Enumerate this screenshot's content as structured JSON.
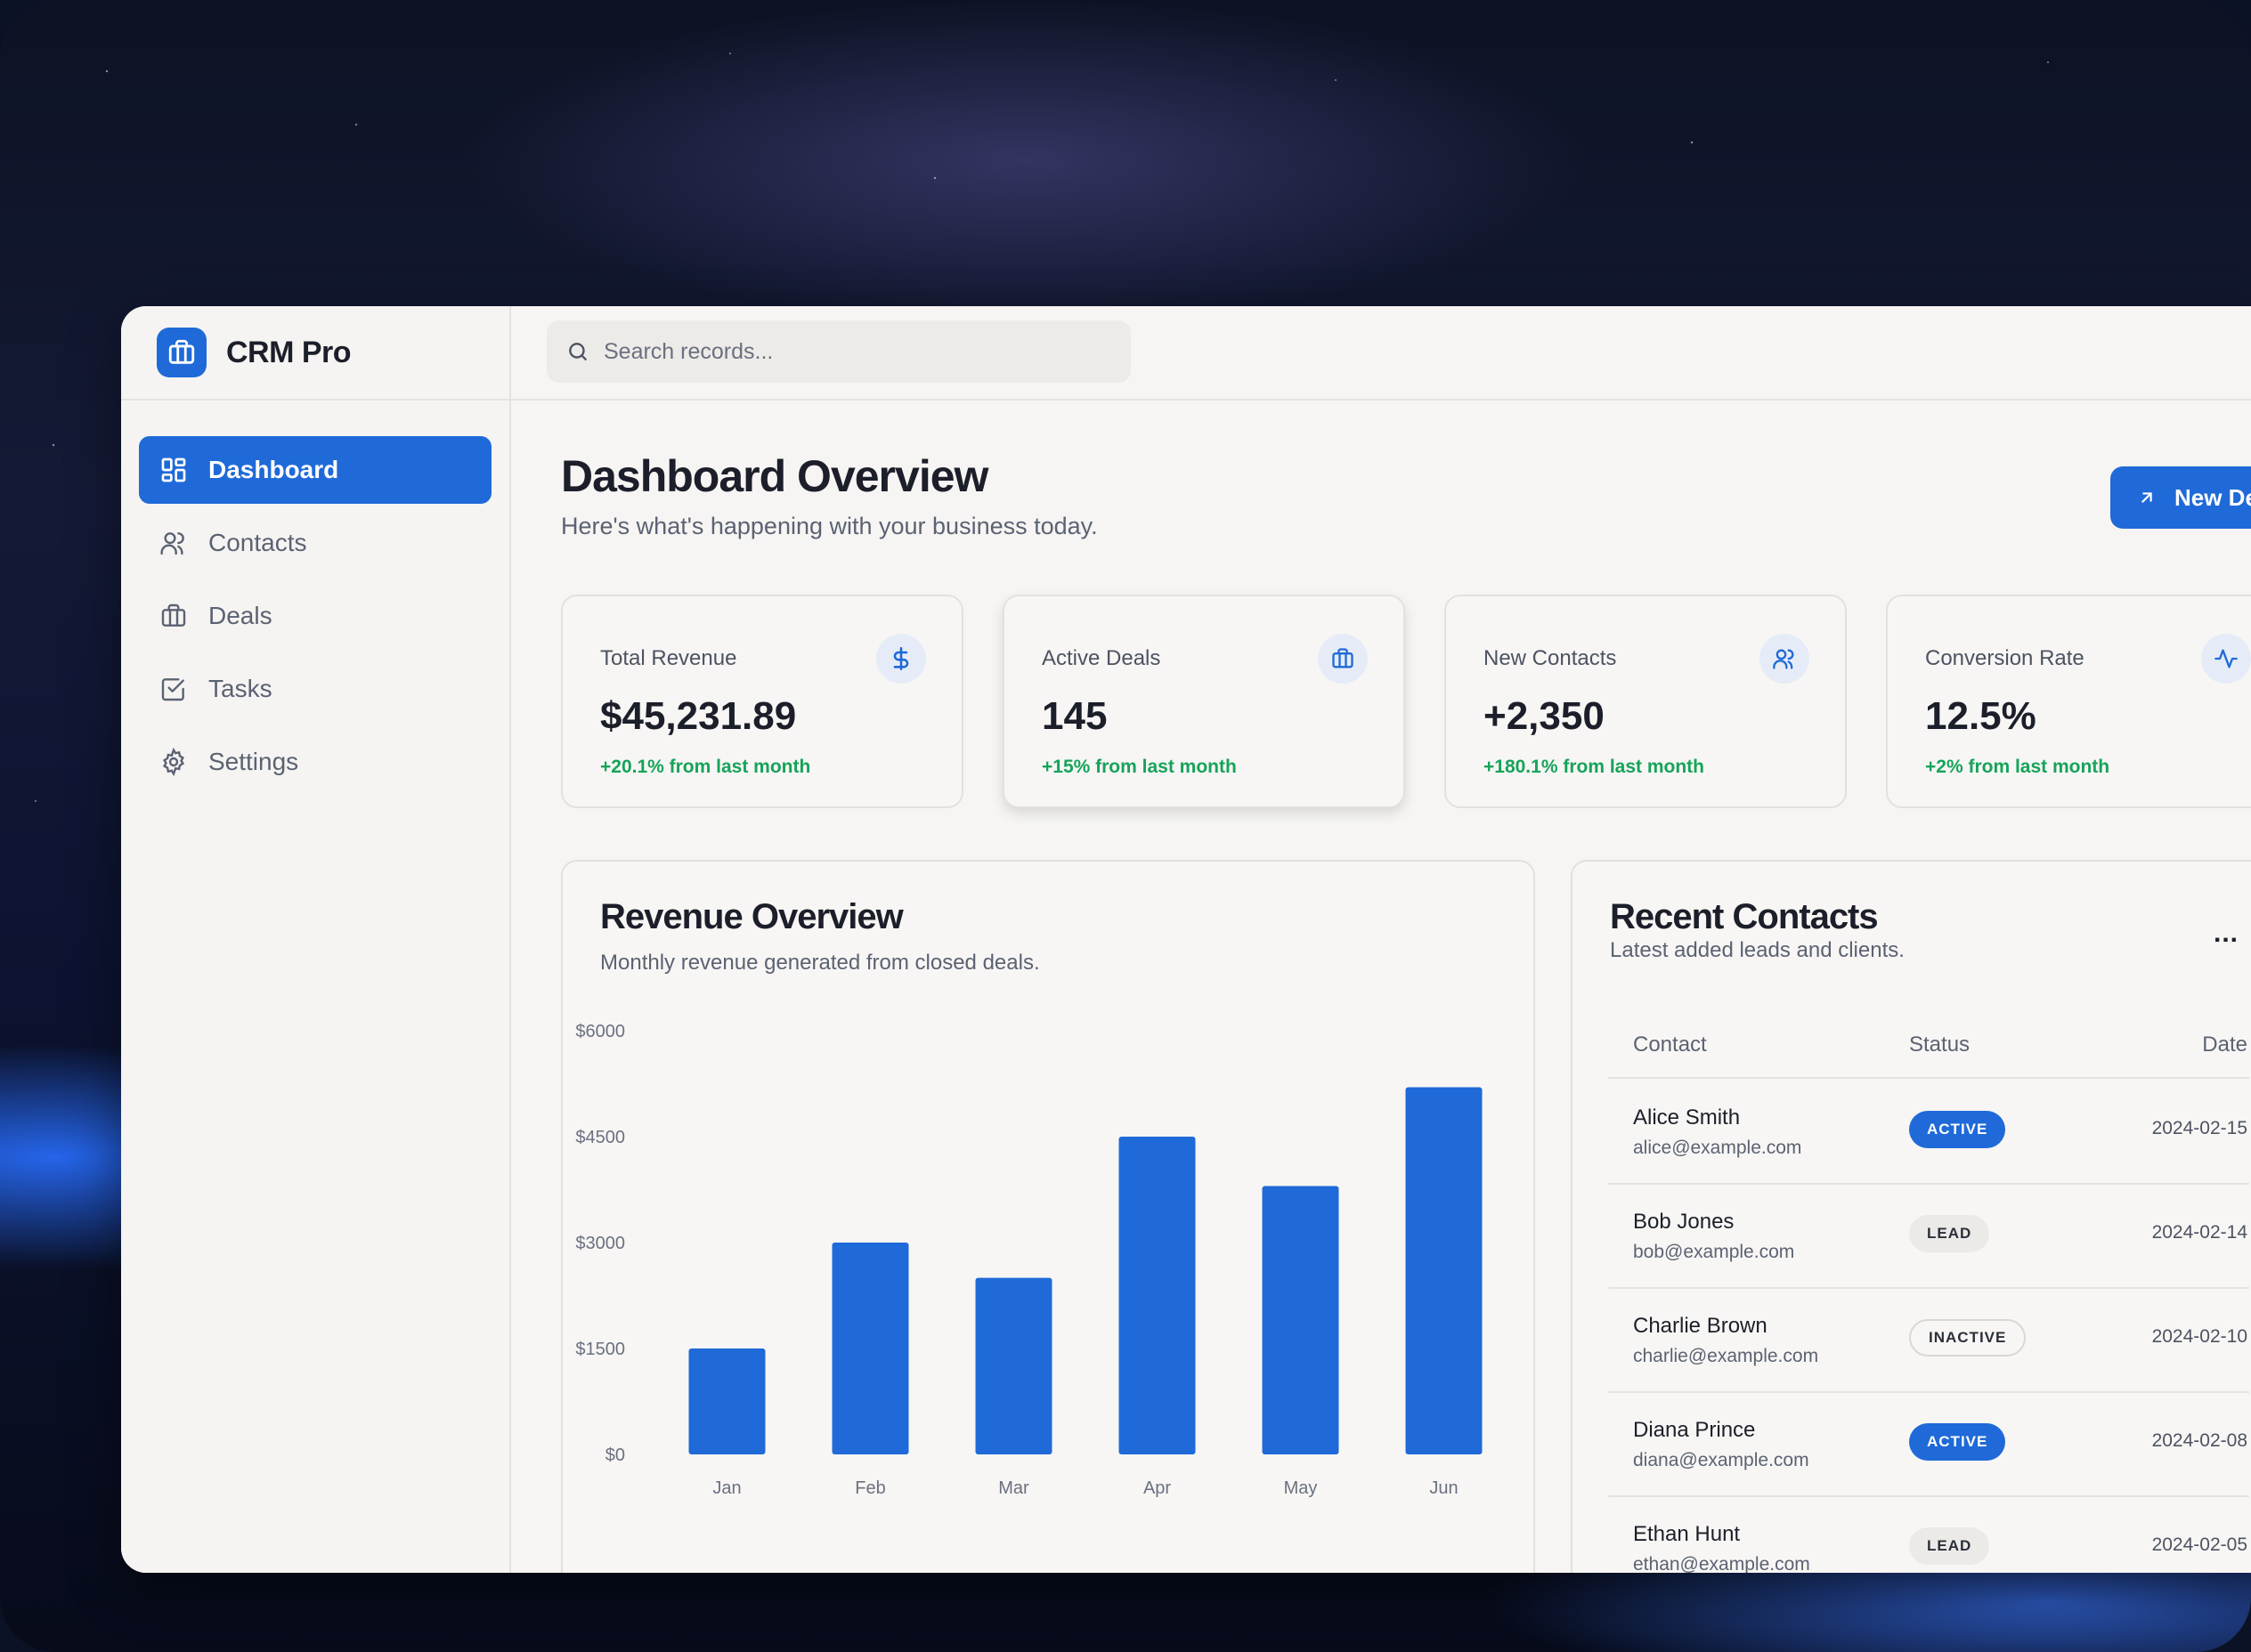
{
  "app": {
    "name": "CRM Pro"
  },
  "sidebar": {
    "items": [
      {
        "label": "Dashboard",
        "icon": "dashboard-icon",
        "active": true
      },
      {
        "label": "Contacts",
        "icon": "users-icon",
        "active": false
      },
      {
        "label": "Deals",
        "icon": "briefcase-icon",
        "active": false
      },
      {
        "label": "Tasks",
        "icon": "checkbox-icon",
        "active": false
      },
      {
        "label": "Settings",
        "icon": "gear-icon",
        "active": false
      }
    ]
  },
  "topbar": {
    "search_placeholder": "Search records..."
  },
  "header": {
    "title": "Dashboard Overview",
    "subtitle": "Here's what's happening with your business today.",
    "new_button": "New Deal"
  },
  "stats": [
    {
      "label": "Total Revenue",
      "value": "$45,231.89",
      "delta": "+20.1% from last month",
      "icon": "dollar-icon"
    },
    {
      "label": "Active Deals",
      "value": "145",
      "delta": "+15% from last month",
      "icon": "briefcase-icon"
    },
    {
      "label": "New Contacts",
      "value": "+2,350",
      "delta": "+180.1% from last month",
      "icon": "users-icon"
    },
    {
      "label": "Conversion Rate",
      "value": "12.5%",
      "delta": "+2% from last month",
      "icon": "activity-icon"
    }
  ],
  "revenue": {
    "title": "Revenue Overview",
    "subtitle": "Monthly revenue generated from closed deals."
  },
  "chart_data": {
    "type": "bar",
    "categories": [
      "Jan",
      "Feb",
      "Mar",
      "Apr",
      "May",
      "Jun"
    ],
    "values": [
      1500,
      3000,
      2500,
      4500,
      3800,
      5200
    ],
    "ylim": [
      0,
      6000
    ],
    "yticks": [
      0,
      1500,
      3000,
      4500,
      6000
    ],
    "ytick_labels": [
      "$0",
      "$1500",
      "$3000",
      "$4500",
      "$6000"
    ],
    "bar_color": "#1f6ad8",
    "grid": false
  },
  "contacts": {
    "title": "Recent Contacts",
    "subtitle": "Latest added leads and clients.",
    "more_label": "...",
    "columns": [
      "Contact",
      "Status",
      "Date"
    ],
    "rows": [
      {
        "name": "Alice Smith",
        "email": "alice@example.com",
        "status": "ACTIVE",
        "status_type": "active",
        "date": "2024-02-15"
      },
      {
        "name": "Bob Jones",
        "email": "bob@example.com",
        "status": "LEAD",
        "status_type": "lead",
        "date": "2024-02-14"
      },
      {
        "name": "Charlie Brown",
        "email": "charlie@example.com",
        "status": "INACTIVE",
        "status_type": "inactive",
        "date": "2024-02-10"
      },
      {
        "name": "Diana Prince",
        "email": "diana@example.com",
        "status": "ACTIVE",
        "status_type": "active",
        "date": "2024-02-08"
      },
      {
        "name": "Ethan Hunt",
        "email": "ethan@example.com",
        "status": "LEAD",
        "status_type": "lead",
        "date": "2024-02-05"
      }
    ]
  },
  "colors": {
    "accent": "#1f6ad8",
    "positive": "#16a35a",
    "notification": "#e02424"
  }
}
